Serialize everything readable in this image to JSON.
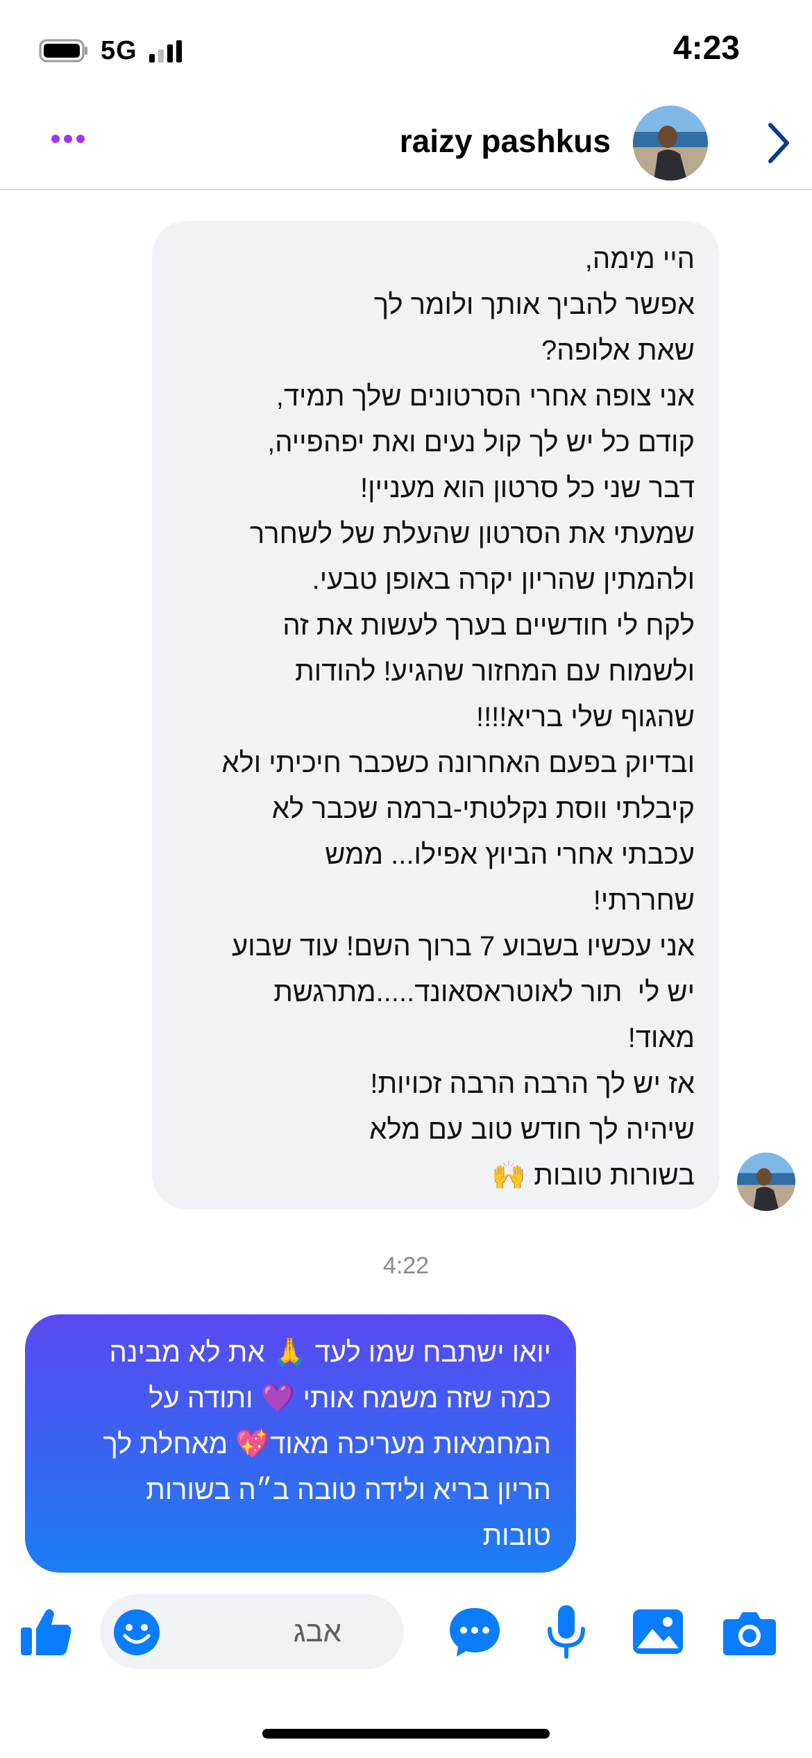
{
  "status_bar": {
    "network": "5G",
    "time": "4:23",
    "battery_icon": "battery-icon",
    "signal_icon": "signal-bars-icon"
  },
  "header": {
    "contact_name": "raizy pashkus",
    "more_icon": "more-dots-icon",
    "next_icon": "chevron-right-icon",
    "accent_color": "#a033ff"
  },
  "conversation": {
    "incoming_message_lines": [
      "היי מימה,",
      "אפשר להביך אותך ולומר לך",
      "שאת אלופה?",
      "אני צופה אחרי הסרטונים שלך תמיד,",
      "קודם כל יש לך קול נעים ואת יפהפייה,",
      "דבר שני כל סרטון הוא מעניין!",
      "שמעתי את הסרטון שהעלת של לשחרר",
      "ולהמתין שהריון יקרה באופן טבעי.",
      "לקח לי חודשיים בערך לעשות את זה",
      "ולשמוח עם המחזור שהגיע! להודות",
      "שהגוף שלי בריא!!!!",
      "ובדיוק בפעם האחרונה כשכבר חיכיתי ולא",
      "קיבלתי ווסת נקלטתי-ברמה שכבר לא",
      "עכבתי אחרי הביוץ אפילו... ממש",
      "שחררתי!",
      "אני עכשיו בשבוע 7 ברוך השם! עוד שבוע",
      "יש לי  תור לאוטראסאונד.....מתרגשת",
      "מאוד!",
      "אז יש לך הרבה הרבה זכויות!",
      "שיהיה לך חודש טוב עם מלא",
      "בשורות טובות 🙌"
    ],
    "timestamp": "4:22",
    "outgoing_message_lines": [
      "יואו ישתבח שמו לעד 🙏 את לא מבינה",
      "כמה שזה משמח אותי 💜 ותודה על",
      "המחמאות מעריכה מאוד💖 מאחלת לך",
      "הריון בריא ולידה טובה ב״ה בשורות",
      "טובות"
    ],
    "outgoing_gradient": [
      "#5a49f0",
      "#1c7ef4"
    ]
  },
  "composer": {
    "placeholder": "אבג",
    "icons": [
      "thumbs-up-icon",
      "emoji-icon",
      "chat-bubble-icon",
      "microphone-icon",
      "image-icon",
      "camera-icon"
    ],
    "icon_color": "#0a7cff"
  }
}
